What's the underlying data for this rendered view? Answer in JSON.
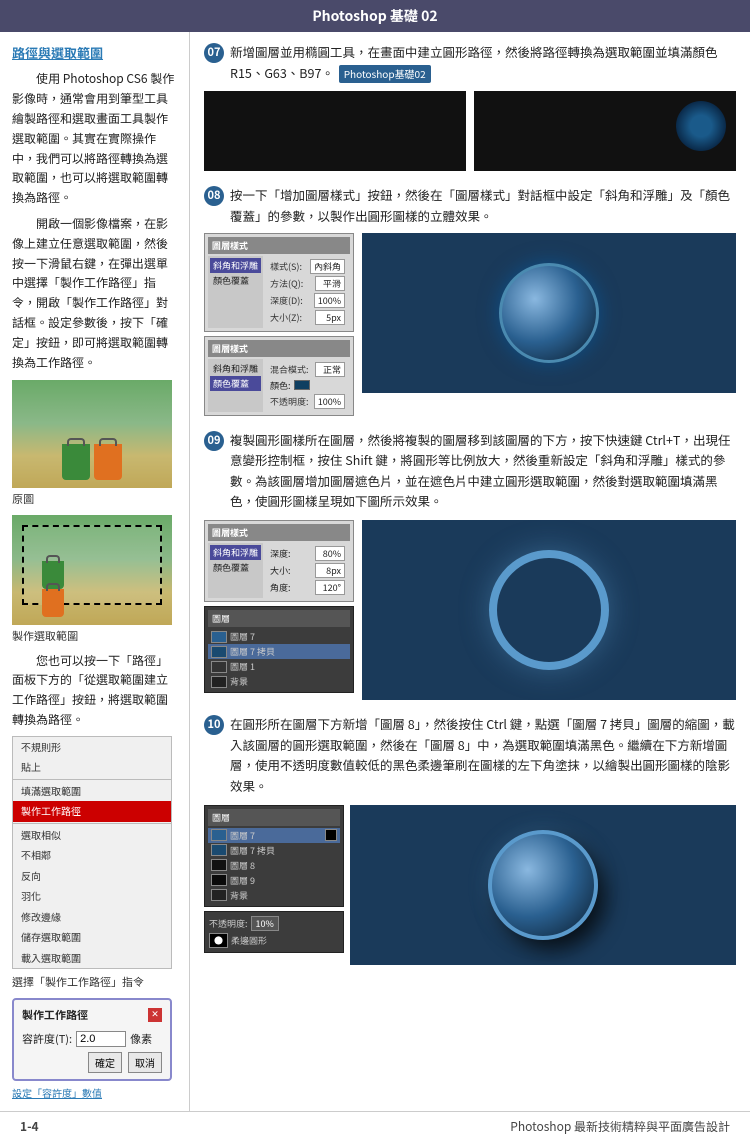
{
  "header": {
    "title": "Photoshop 基礎 02"
  },
  "sidebar": {
    "section_title": "路徑與選取範圍",
    "paragraphs": [
      "使用 Photoshop CS6 製作影像時，通常會用到筆型工具繪製路徑和選取畫面工具製作選取範圍。其實在實際操作中，我們可以將路徑轉換為選取範圍，也可以將選取範圍轉換為路徑。",
      "開啟一個影像檔案，在影像上建立任意選取範圍，然後按一下滑鼠右鍵，在彈出選單中選擇「製作工作路徑」指令，開啟「製作工作路徑」對話框。設定參數後，按下「確定」按鈕，即可將選取範圍轉換為工作路徑。",
      "您也可以按一下「路徑」面板下方的「從選取範圍建立工作路徑」按鈕，將選取範圍轉換為路徑。"
    ],
    "original_label": "原圖",
    "selection_label": "製作選取範圍",
    "menu_items": [
      "不規則形",
      "貼上",
      "",
      "填滿選取範圍",
      "製作工作路徑",
      "",
      "選取相似",
      "不相鄰",
      "反向",
      "羽化",
      "修改邊緣",
      "儲存選取範圍",
      "載入選取範圍"
    ],
    "highlighted_menu": "製作工作路徑",
    "selected_cmd_label": "選擇「製作工作路徑」指令",
    "dialog": {
      "title": "製作工作路徑",
      "label": "容許度(T):",
      "value": "2.0",
      "unit": "像素",
      "btn_ok": "確定",
      "btn_cancel": "取消"
    },
    "dialog_footer": "設定「容許度」數值"
  },
  "steps": [
    {
      "number": "07",
      "text": "新增圖層並用橢圓工具，在畫面中建立圓形路徑，然後將路徑轉換為選取範圍並填滿顏色 R15、G63、B97。",
      "badge": "Photoshop基礎02"
    },
    {
      "number": "08",
      "text": "按一下「增加圖層樣式」按鈕，然後在「圖層樣式」對話框中設定「斜角和浮雕」及「顏色覆蓋」的參數，以製作出圓形圖樣的立體效果。"
    },
    {
      "number": "09",
      "text": "複製圓形圖樣所在圖層，然後將複製的圖層移到該圖層的下方，按下快速鍵 Ctrl+T，出現任意變形控制框，按住 Shift 鍵，將圓形等比例放大，然後重新設定「斜角和浮雕」樣式的參數。為該圖層增加圖層遮色片，並在遮色片中建立圓形選取範圍，然後對選取範圍填滿黑色，使圓形圖樣呈現如下圖所示效果。"
    },
    {
      "number": "10",
      "text": "在圓形所在圖層下方新增「圖層 8」，然後按住 Ctrl 鍵，點選「圖層 7 拷貝」圖層的縮圖，載入該圖層的圓形選取範圍，然後在「圖層 8」中，為選取範圍填滿黑色。繼續在下方新增圖層，使用不透明度數值較低的黑色柔邊筆刷在圖樣的左下角塗抹，以繪製出圓形圖樣的陰影效果。"
    }
  ],
  "footer": {
    "page": "1-4",
    "title": "Photoshop 最新技術精粹與平面廣告設計"
  },
  "dialog08": {
    "title": "圖層樣式",
    "effect1": "斜角和浮雕",
    "effect2": "顏色覆蓋"
  }
}
